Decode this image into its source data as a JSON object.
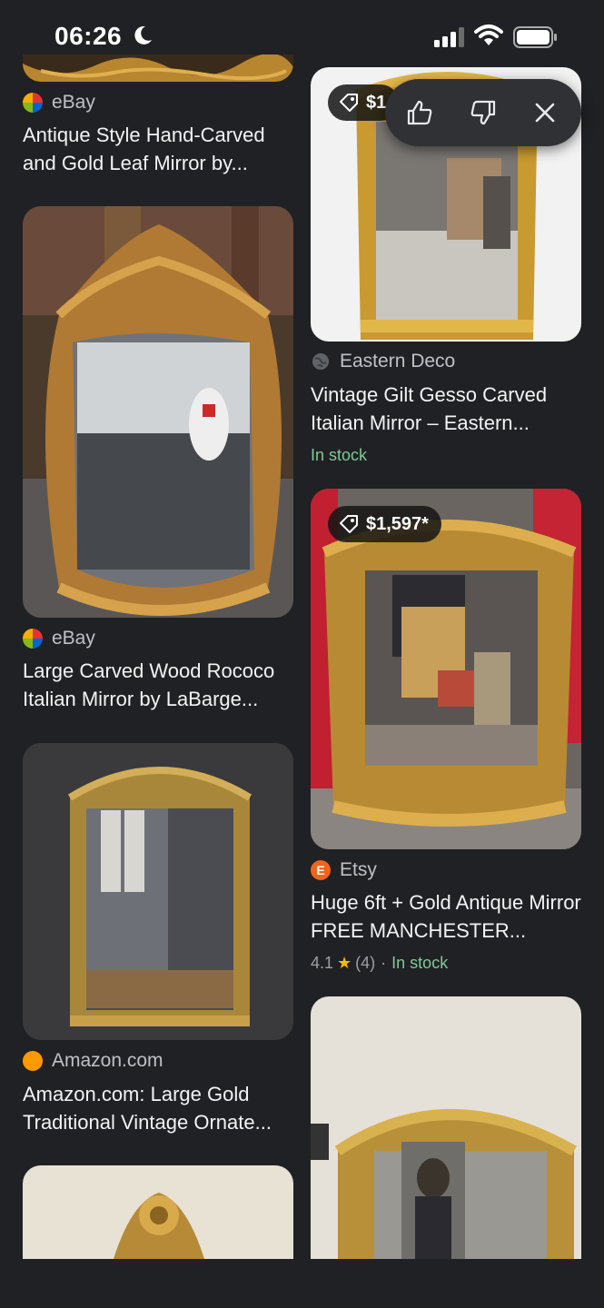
{
  "status": {
    "time": "06:26"
  },
  "left": [
    {
      "source": "eBay",
      "title": "Antique Style Hand-Carved and Gold Leaf Mirror by..."
    },
    {
      "source": "eBay",
      "title": "Large Carved Wood Rococo Italian Mirror by LaBarge..."
    },
    {
      "source": "Amazon.com",
      "title": "Amazon.com: Large Gold Traditional Vintage Ornate..."
    }
  ],
  "right": [
    {
      "price": "$1",
      "source": "Eastern Deco",
      "title": "Vintage Gilt Gesso Carved Italian Mirror – Eastern...",
      "stock": "In stock"
    },
    {
      "price": "$1,597*",
      "source": "Etsy",
      "title": "Huge 6ft + Gold Antique Mirror FREE MANCHESTER...",
      "rating": "4.1",
      "reviews": "(4)",
      "sep": "·",
      "stock": "In stock"
    }
  ],
  "colors": {
    "background": "#202124",
    "stock_green": "#81c995",
    "star": "#fbbc04",
    "etsy": "#f1641e",
    "amazon": "#ff9900"
  },
  "icons": [
    "moon-icon",
    "signal-icon",
    "wifi-icon",
    "battery-icon",
    "thumbs-up-icon",
    "thumbs-down-icon",
    "close-icon",
    "tag-icon",
    "globe-icon",
    "star-icon"
  ]
}
